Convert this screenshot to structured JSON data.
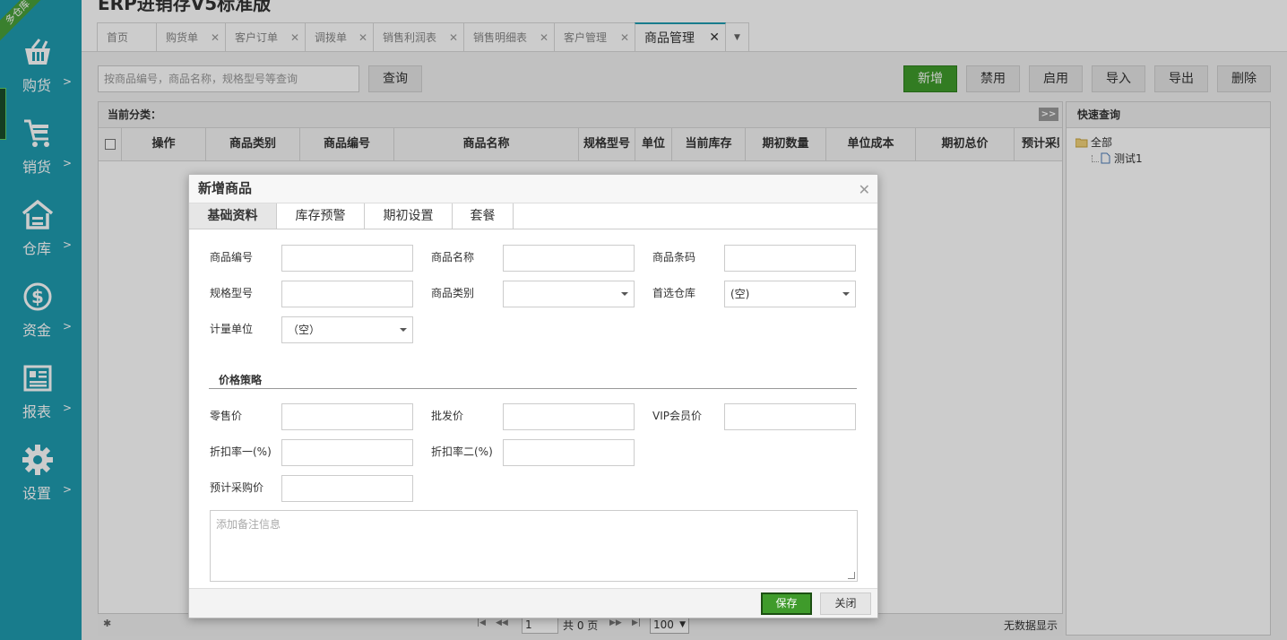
{
  "app": {
    "title": "ERP进销存V5标准版",
    "corner_badge": "多仓库"
  },
  "sidebar": {
    "items": [
      {
        "label": "购货",
        "icon": "basket-icon"
      },
      {
        "label": "销货",
        "icon": "cart-icon"
      },
      {
        "label": "仓库",
        "icon": "warehouse-icon"
      },
      {
        "label": "资金",
        "icon": "dollar-icon"
      },
      {
        "label": "报表",
        "icon": "report-icon"
      },
      {
        "label": "设置",
        "icon": "gear-icon"
      }
    ],
    "chevron": ">"
  },
  "tabs": [
    {
      "label": "首页"
    },
    {
      "label": "购货单"
    },
    {
      "label": "客户订单"
    },
    {
      "label": "调拨单"
    },
    {
      "label": "销售利润表"
    },
    {
      "label": "销售明细表"
    },
    {
      "label": "客户管理"
    },
    {
      "label": "商品管理"
    }
  ],
  "toolbar": {
    "search_placeholder": "按商品编号，商品名称，规格型号等查询",
    "query": "查询",
    "add": "新增",
    "disable": "禁用",
    "enable": "启用",
    "import": "导入",
    "export": "导出",
    "delete": "删除"
  },
  "grid": {
    "caption": "当前分类：",
    "expand": ">>",
    "columns": [
      "操作",
      "商品类别",
      "商品编号",
      "商品名称",
      "规格型号",
      "单位",
      "当前库存",
      "期初数量",
      "单位成本",
      "期初总价",
      "预计采购价"
    ]
  },
  "pager": {
    "page": "1",
    "total": "共 0 页",
    "size": "100",
    "empty": "无数据显示"
  },
  "quick": {
    "title": "快速查询",
    "root": "全部",
    "child": "测试1"
  },
  "dialog": {
    "title": "新增商品",
    "tabs": [
      "基础资料",
      "库存预警",
      "期初设置",
      "套餐"
    ],
    "labels": {
      "code": "商品编号",
      "name": "商品名称",
      "barcode": "商品条码",
      "spec": "规格型号",
      "category": "商品类别",
      "warehouse": "首选仓库",
      "unit": "计量单位",
      "retail": "零售价",
      "wholesale": "批发价",
      "vip": "VIP会员价",
      "discount1": "折扣率一(%)",
      "discount2": "折扣率二(%)",
      "purchase": "预计采购价"
    },
    "values": {
      "warehouse": "(空)",
      "unit": "（空）"
    },
    "section_price": "价格策略",
    "remark_placeholder": "添加备注信息",
    "save": "保存",
    "close": "关闭"
  }
}
